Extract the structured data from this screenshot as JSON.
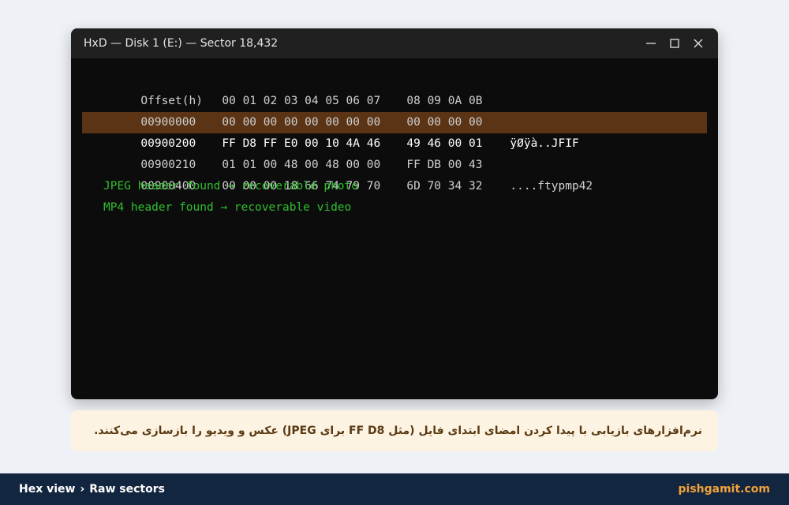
{
  "window": {
    "title": "HxD — Disk 1 (E:) — Sector 18,432",
    "controls": [
      "minimize-icon",
      "maximize-icon",
      "close-icon"
    ]
  },
  "hex_view": {
    "header": {
      "offset": "Offset(h)",
      "bytes1": "00 01 02 03 04 05 06 07",
      "bytes2": "08 09 0A 0B",
      "ascii": ""
    },
    "rows": [
      {
        "offset": "00900000",
        "bytes1": "00 00 00 00 00 00 00 00",
        "bytes2": "00 00 00 00",
        "ascii": ""
      },
      {
        "offset": "00900200",
        "bytes1": "FF D8 FF E0 00 10 4A 46",
        "bytes2": "49 46 00 01",
        "ascii": "ÿØÿà..JFIF",
        "highlighted": true
      },
      {
        "offset": "00900210",
        "bytes1": "01 01 00 48 00 48 00 00",
        "bytes2": "FF DB 00 43",
        "ascii": ""
      },
      {
        "offset": "00900400",
        "bytes1": "00 00 00 18 66 74 79 70",
        "bytes2": "6D 70 34 32",
        "ascii": "....ftypmp42"
      }
    ],
    "notes": [
      "JPEG header found → recoverable photo",
      "MP4 header found → recoverable video"
    ],
    "highlight_color": "#5a3415",
    "note_color": "#2fbf2f"
  },
  "caption": "نرم‌افزارهای بازیابی با پیدا کردن امضای ابتدای فایل (مثل FF D8 برای JPEG) عکس و ویدیو را بازسازی می‌کنند.",
  "footer": {
    "crumb1": "Hex view",
    "separator": "›",
    "crumb2": "Raw sectors",
    "site": "pishgamit.com"
  }
}
